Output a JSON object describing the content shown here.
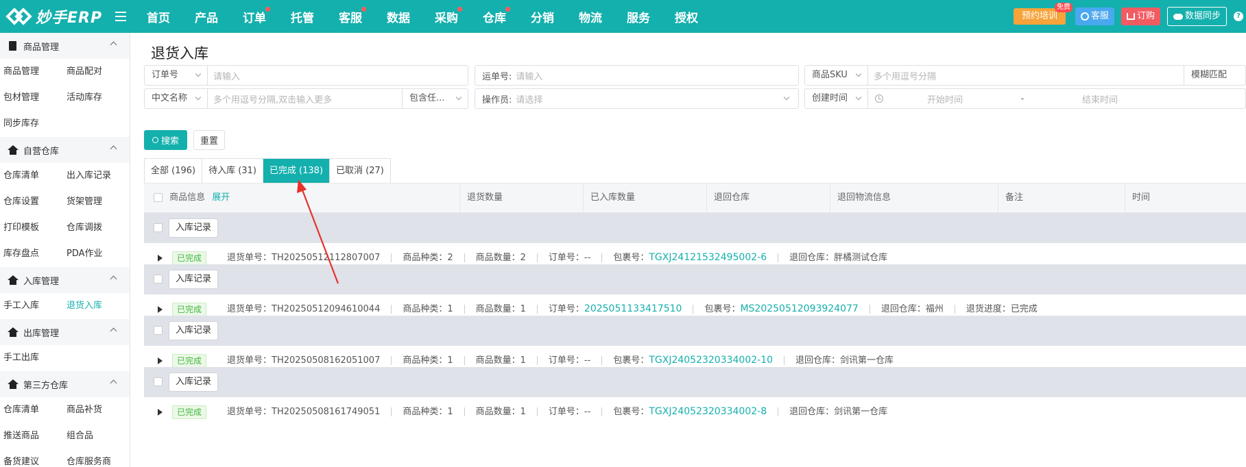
{
  "app": {
    "logo_text": "妙手ERP"
  },
  "topnav": [
    {
      "label": "首页",
      "dot": false
    },
    {
      "label": "产品",
      "dot": false
    },
    {
      "label": "订单",
      "dot": true
    },
    {
      "label": "托管",
      "dot": false
    },
    {
      "label": "客服",
      "dot": true
    },
    {
      "label": "数据",
      "dot": false
    },
    {
      "label": "采购",
      "dot": true
    },
    {
      "label": "仓库",
      "dot": true
    },
    {
      "label": "分销",
      "dot": false
    },
    {
      "label": "物流",
      "dot": false
    },
    {
      "label": "服务",
      "dot": false
    },
    {
      "label": "授权",
      "dot": false
    }
  ],
  "top_actions": {
    "training": "预约培训",
    "training_badge": "免费",
    "customer_service": "客服",
    "order": "订购",
    "data_sync": "数据同步",
    "help": "?"
  },
  "sidebar": {
    "groups": [
      {
        "title": "商品管理",
        "icon": "clipboard-icon",
        "items": [
          {
            "label": "商品管理",
            "active": false
          },
          {
            "label": "商品配对",
            "active": false
          },
          {
            "label": "包材管理",
            "active": false
          },
          {
            "label": "活动库存",
            "active": false
          },
          {
            "label": "同步库存",
            "active": false
          }
        ]
      },
      {
        "title": "自营仓库",
        "icon": "warehouse-icon",
        "items": [
          {
            "label": "仓库清单",
            "active": false
          },
          {
            "label": "出入库记录",
            "active": false
          },
          {
            "label": "仓库设置",
            "active": false
          },
          {
            "label": "货架管理",
            "active": false
          },
          {
            "label": "打印模板",
            "active": false
          },
          {
            "label": "仓库调拨",
            "active": false
          },
          {
            "label": "库存盘点",
            "active": false
          },
          {
            "label": "PDA作业",
            "active": false
          }
        ]
      },
      {
        "title": "入库管理",
        "icon": "warehouse-icon",
        "items": [
          {
            "label": "手工入库",
            "active": false
          },
          {
            "label": "退货入库",
            "active": true
          }
        ]
      },
      {
        "title": "出库管理",
        "icon": "warehouse-icon",
        "items": [
          {
            "label": "手工出库",
            "active": false
          }
        ]
      },
      {
        "title": "第三方仓库",
        "icon": "warehouse-icon",
        "items": [
          {
            "label": "仓库清单",
            "active": false
          },
          {
            "label": "商品补货",
            "active": false
          },
          {
            "label": "推送商品",
            "active": false
          },
          {
            "label": "组合品",
            "active": false
          },
          {
            "label": "备货建议",
            "active": false
          },
          {
            "label": "仓库服务商",
            "active": false
          }
        ]
      }
    ]
  },
  "page": {
    "title": "退货入库"
  },
  "filters": {
    "order_no_select": "订单号",
    "order_no_placeholder": "请输入",
    "return_no_label": "运单号:",
    "return_no_placeholder": "请输入",
    "sku_select": "商品SKU",
    "sku_placeholder": "多个用逗号分隔",
    "fuzzy_select": "模糊匹配",
    "cn_name_select": "中文名称",
    "cn_name_placeholder": "多个用逗号分隔,双击输入更多",
    "contains_select": "包含任...",
    "operator_label": "操作员:",
    "operator_placeholder": "请选择",
    "time_select": "创建时间",
    "start_placeholder": "开始时间",
    "range_sep": "-",
    "end_placeholder": "结束时间",
    "search_button": "搜索",
    "reset_button": "重置"
  },
  "tabs": [
    {
      "label": "全部 (196)",
      "active": false
    },
    {
      "label": "待入库 (31)",
      "active": false
    },
    {
      "label": "已完成 (138)",
      "active": true
    },
    {
      "label": "已取消 (27)",
      "active": false
    }
  ],
  "table": {
    "headers": {
      "product_info": "商品信息",
      "expand": "展开",
      "return_qty": "退货数量",
      "stocked_qty": "已入库数量",
      "return_warehouse": "退回仓库",
      "return_logistics": "退回物流信息",
      "remark": "备注",
      "time": "时间"
    },
    "record_button": "入库记录",
    "rows": [
      {
        "status": "已完成",
        "return_no": "退货单号：TH20250512112807007",
        "kinds": "商品种类：2",
        "qty": "商品数量：2",
        "order_label": "订单号：",
        "order_value": "--",
        "package_label": "包裹号：",
        "package_value": "TGXJ24121532495002-6",
        "warehouse": "退回仓库：胖橘测试仓库",
        "progress": ""
      },
      {
        "status": "已完成",
        "return_no": "退货单号：TH20250512094610044",
        "kinds": "商品种类：1",
        "qty": "商品数量：1",
        "order_label": "订单号：",
        "order_value": "2025051133417510",
        "package_label": "包裹号：",
        "package_value": "MS20250512093924077",
        "warehouse": "退回仓库：福州",
        "progress": "退货进度：已完成"
      },
      {
        "status": "已完成",
        "return_no": "退货单号：TH20250508162051007",
        "kinds": "商品种类：1",
        "qty": "商品数量：1",
        "order_label": "订单号：",
        "order_value": "--",
        "package_label": "包裹号：",
        "package_value": "TGXJ24052320334002-10",
        "warehouse": "退回仓库：剑讯第一仓库",
        "progress": ""
      },
      {
        "status": "已完成",
        "return_no": "退货单号：TH20250508161749051",
        "kinds": "商品种类：1",
        "qty": "商品数量：1",
        "order_label": "订单号：",
        "order_value": "--",
        "package_label": "包裹号：",
        "package_value": "TGXJ24052320334002-8",
        "warehouse": "退回仓库：剑讯第一仓库",
        "progress": ""
      }
    ]
  },
  "colors": {
    "brand": "#14b0ad",
    "annotation_arrow": "#e5322d",
    "status_green": "#43b83e"
  }
}
